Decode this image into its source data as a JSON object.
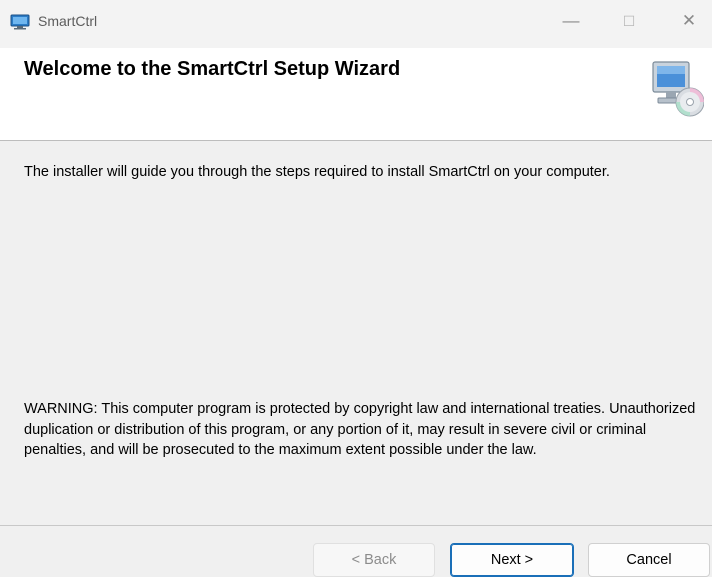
{
  "window": {
    "title": "SmartCtrl",
    "controls": {
      "minimize": "—",
      "maximize": "☐",
      "close": "✕"
    }
  },
  "header": {
    "title": "Welcome to the SmartCtrl Setup Wizard",
    "icon": "computer-cd-icon"
  },
  "body": {
    "intro": "The installer will guide you through the steps required to install SmartCtrl on your computer.",
    "warning": "WARNING: This computer program is protected by copyright law and international treaties. Unauthorized duplication or distribution of this program, or any portion of it, may result in severe civil or criminal penalties, and will be prosecuted to the maximum extent possible under the law."
  },
  "buttons": {
    "back": "< Back",
    "next": "Next >",
    "cancel": "Cancel"
  },
  "colors": {
    "accent": "#1a6fb8",
    "background": "#f0f0f0"
  }
}
